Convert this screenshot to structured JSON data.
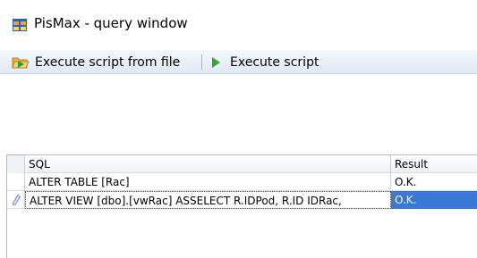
{
  "window": {
    "title": "PisMax - query window",
    "icon": "app-window-icon"
  },
  "toolbar": {
    "execute_from_file_label": "Execute script from file",
    "execute_from_file_icon": "open-folder-run-icon",
    "execute_script_label": "Execute script",
    "execute_script_icon": "play-icon"
  },
  "grid": {
    "columns": [
      "SQL",
      "Result"
    ],
    "rows": [
      {
        "sql": "ALTER TABLE [Rac]",
        "result": "O.K."
      },
      {
        "sql": "ALTER VIEW [dbo].[vwRac] ASSELECT R.IDPod,  R.ID IDRac,",
        "result": "O.K.",
        "selected": true,
        "indicator": "edit-pencil-icon"
      }
    ]
  },
  "colors": {
    "selection": "#3a78d4",
    "toolbar_gradient_top": "#f4f8fd",
    "toolbar_gradient_bottom": "#dfe9f5",
    "play_green": "#3aa335"
  }
}
